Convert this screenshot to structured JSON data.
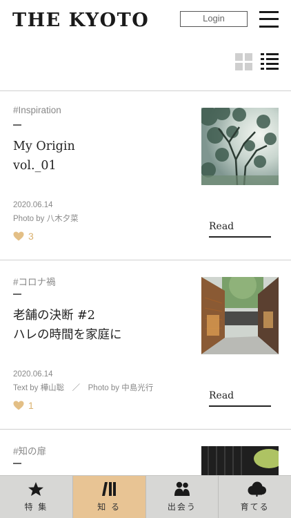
{
  "header": {
    "logo": "THE KYOTO",
    "login_label": "Login"
  },
  "colors": {
    "accent": "#e8c494",
    "heart": "#d9b06e",
    "nav_bg": "#d7d7d5"
  },
  "articles": [
    {
      "tag": "#Inspiration",
      "title_lines": [
        "My Origin",
        "vol._01"
      ],
      "date": "2020.06.14",
      "credit": "Photo by 八木夕菜",
      "likes": "3",
      "read_label": "Read"
    },
    {
      "tag": "#コロナ禍",
      "title_lines": [
        "老舗の決断 #2",
        "ハレの時間を家庭に"
      ],
      "date": "2020.06.14",
      "credit": "Text by 樺山聡　／　Photo by 中島光行",
      "likes": "1",
      "read_label": "Read"
    },
    {
      "tag": "#知の扉"
    }
  ],
  "bottom_nav": [
    {
      "label": "特 集",
      "icon": "star-icon",
      "active": false
    },
    {
      "label": "知 る",
      "icon": "books-icon",
      "active": true
    },
    {
      "label": "出会う",
      "icon": "people-icon",
      "active": false
    },
    {
      "label": "育てる",
      "icon": "cloud-icon",
      "active": false
    }
  ]
}
